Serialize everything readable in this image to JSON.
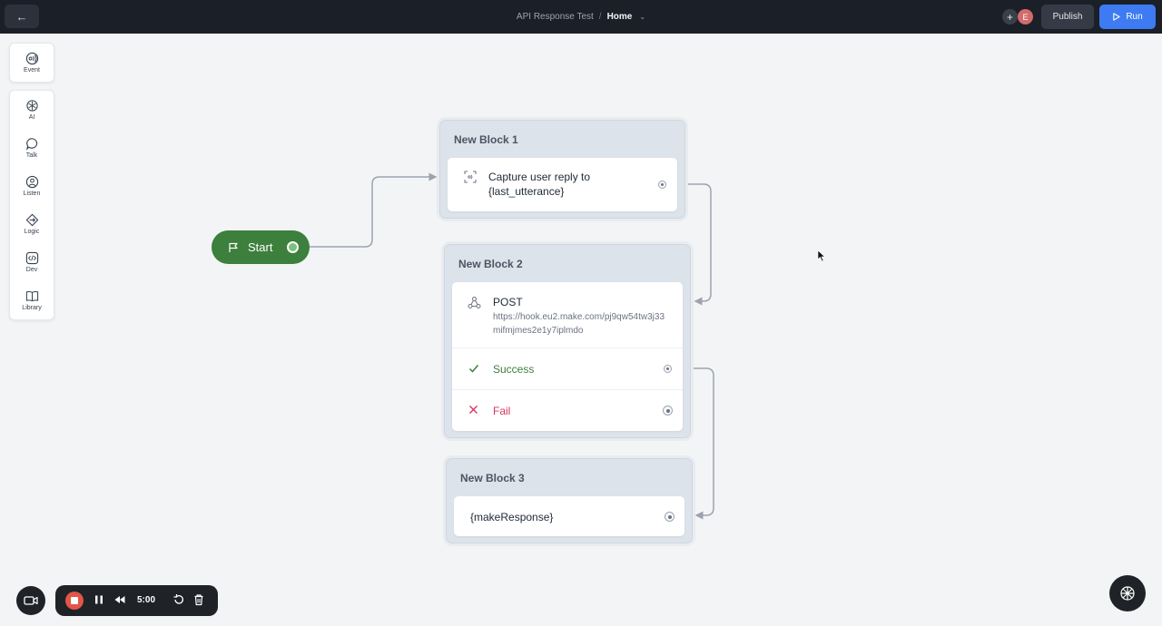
{
  "topbar": {
    "back_icon": "arrow-left-icon",
    "project_name": "API Response Test",
    "separator": "/",
    "current_page": "Home",
    "add_icon": "plus",
    "avatar_initial": "E",
    "publish_label": "Publish",
    "run_label": "Run",
    "colors": {
      "run": "#3e7bf2",
      "avatar": "#d46a6a",
      "bar": "#1b1f27"
    }
  },
  "toolbar": {
    "event": {
      "label": "Event",
      "icon": "event-icon"
    },
    "items": [
      {
        "label": "AI",
        "icon": "ai-icon"
      },
      {
        "label": "Talk",
        "icon": "talk-icon"
      },
      {
        "label": "Listen",
        "icon": "listen-icon"
      },
      {
        "label": "Logic",
        "icon": "logic-icon"
      },
      {
        "label": "Dev",
        "icon": "code-icon"
      },
      {
        "label": "Library",
        "icon": "book-icon"
      }
    ]
  },
  "canvas": {
    "start": {
      "label": "Start",
      "color": "#3d7f3d"
    },
    "blocks": [
      {
        "title": "New Block 1",
        "step": {
          "type": "capture",
          "text": "Capture user reply to {last_utterance}"
        }
      },
      {
        "title": "New Block 2",
        "step": {
          "type": "api",
          "method": "POST",
          "url": "https://hook.eu2.make.com/pj9qw54tw3j33mifmjmes2e1y7iplmdo",
          "success_label": "Success",
          "fail_label": "Fail"
        }
      },
      {
        "title": "New Block 3",
        "step": {
          "type": "text",
          "text": "{makeResponse}"
        }
      }
    ],
    "colors": {
      "success": "#3d7f3d",
      "fail": "#d6365f"
    }
  },
  "recorder": {
    "time": "5:00",
    "stop_color": "#e25548"
  }
}
